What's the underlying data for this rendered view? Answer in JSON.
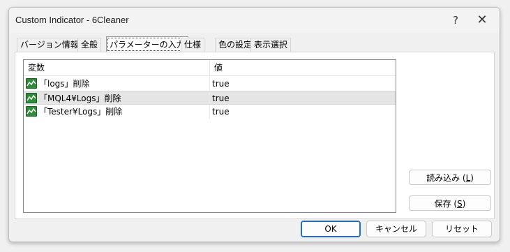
{
  "window": {
    "title": "Custom Indicator - 6Cleaner",
    "help_glyph": "?",
    "close_glyph": "✕"
  },
  "tabs": [
    {
      "label": "バージョン情報"
    },
    {
      "label": "全般"
    },
    {
      "label": "パラメーターの入力"
    },
    {
      "label": "仕様"
    },
    {
      "label": "色の設定"
    },
    {
      "label": "表示選択"
    }
  ],
  "active_tab_index": 2,
  "table": {
    "columns": [
      "変数",
      "値"
    ],
    "rows": [
      {
        "name": "「logs」削除",
        "value": "true"
      },
      {
        "name": "「MQL4¥Logs」削除",
        "value": "true"
      },
      {
        "name": "「Tester¥Logs」削除",
        "value": "true"
      }
    ],
    "selected_row_index": 1
  },
  "side_buttons": {
    "load_label": "読み込み (",
    "load_key": "L",
    "load_suffix": ")",
    "save_label": "保存 (",
    "save_key": "S",
    "save_suffix": ")"
  },
  "footer": {
    "ok_label": "OK",
    "cancel_label": "キャンセル",
    "reset_label": "リセット"
  },
  "colors": {
    "icon_green": "#2e8b3a",
    "ok_border": "#1f6fc5"
  },
  "icons": {
    "param_icon": "chart-wave-icon"
  }
}
